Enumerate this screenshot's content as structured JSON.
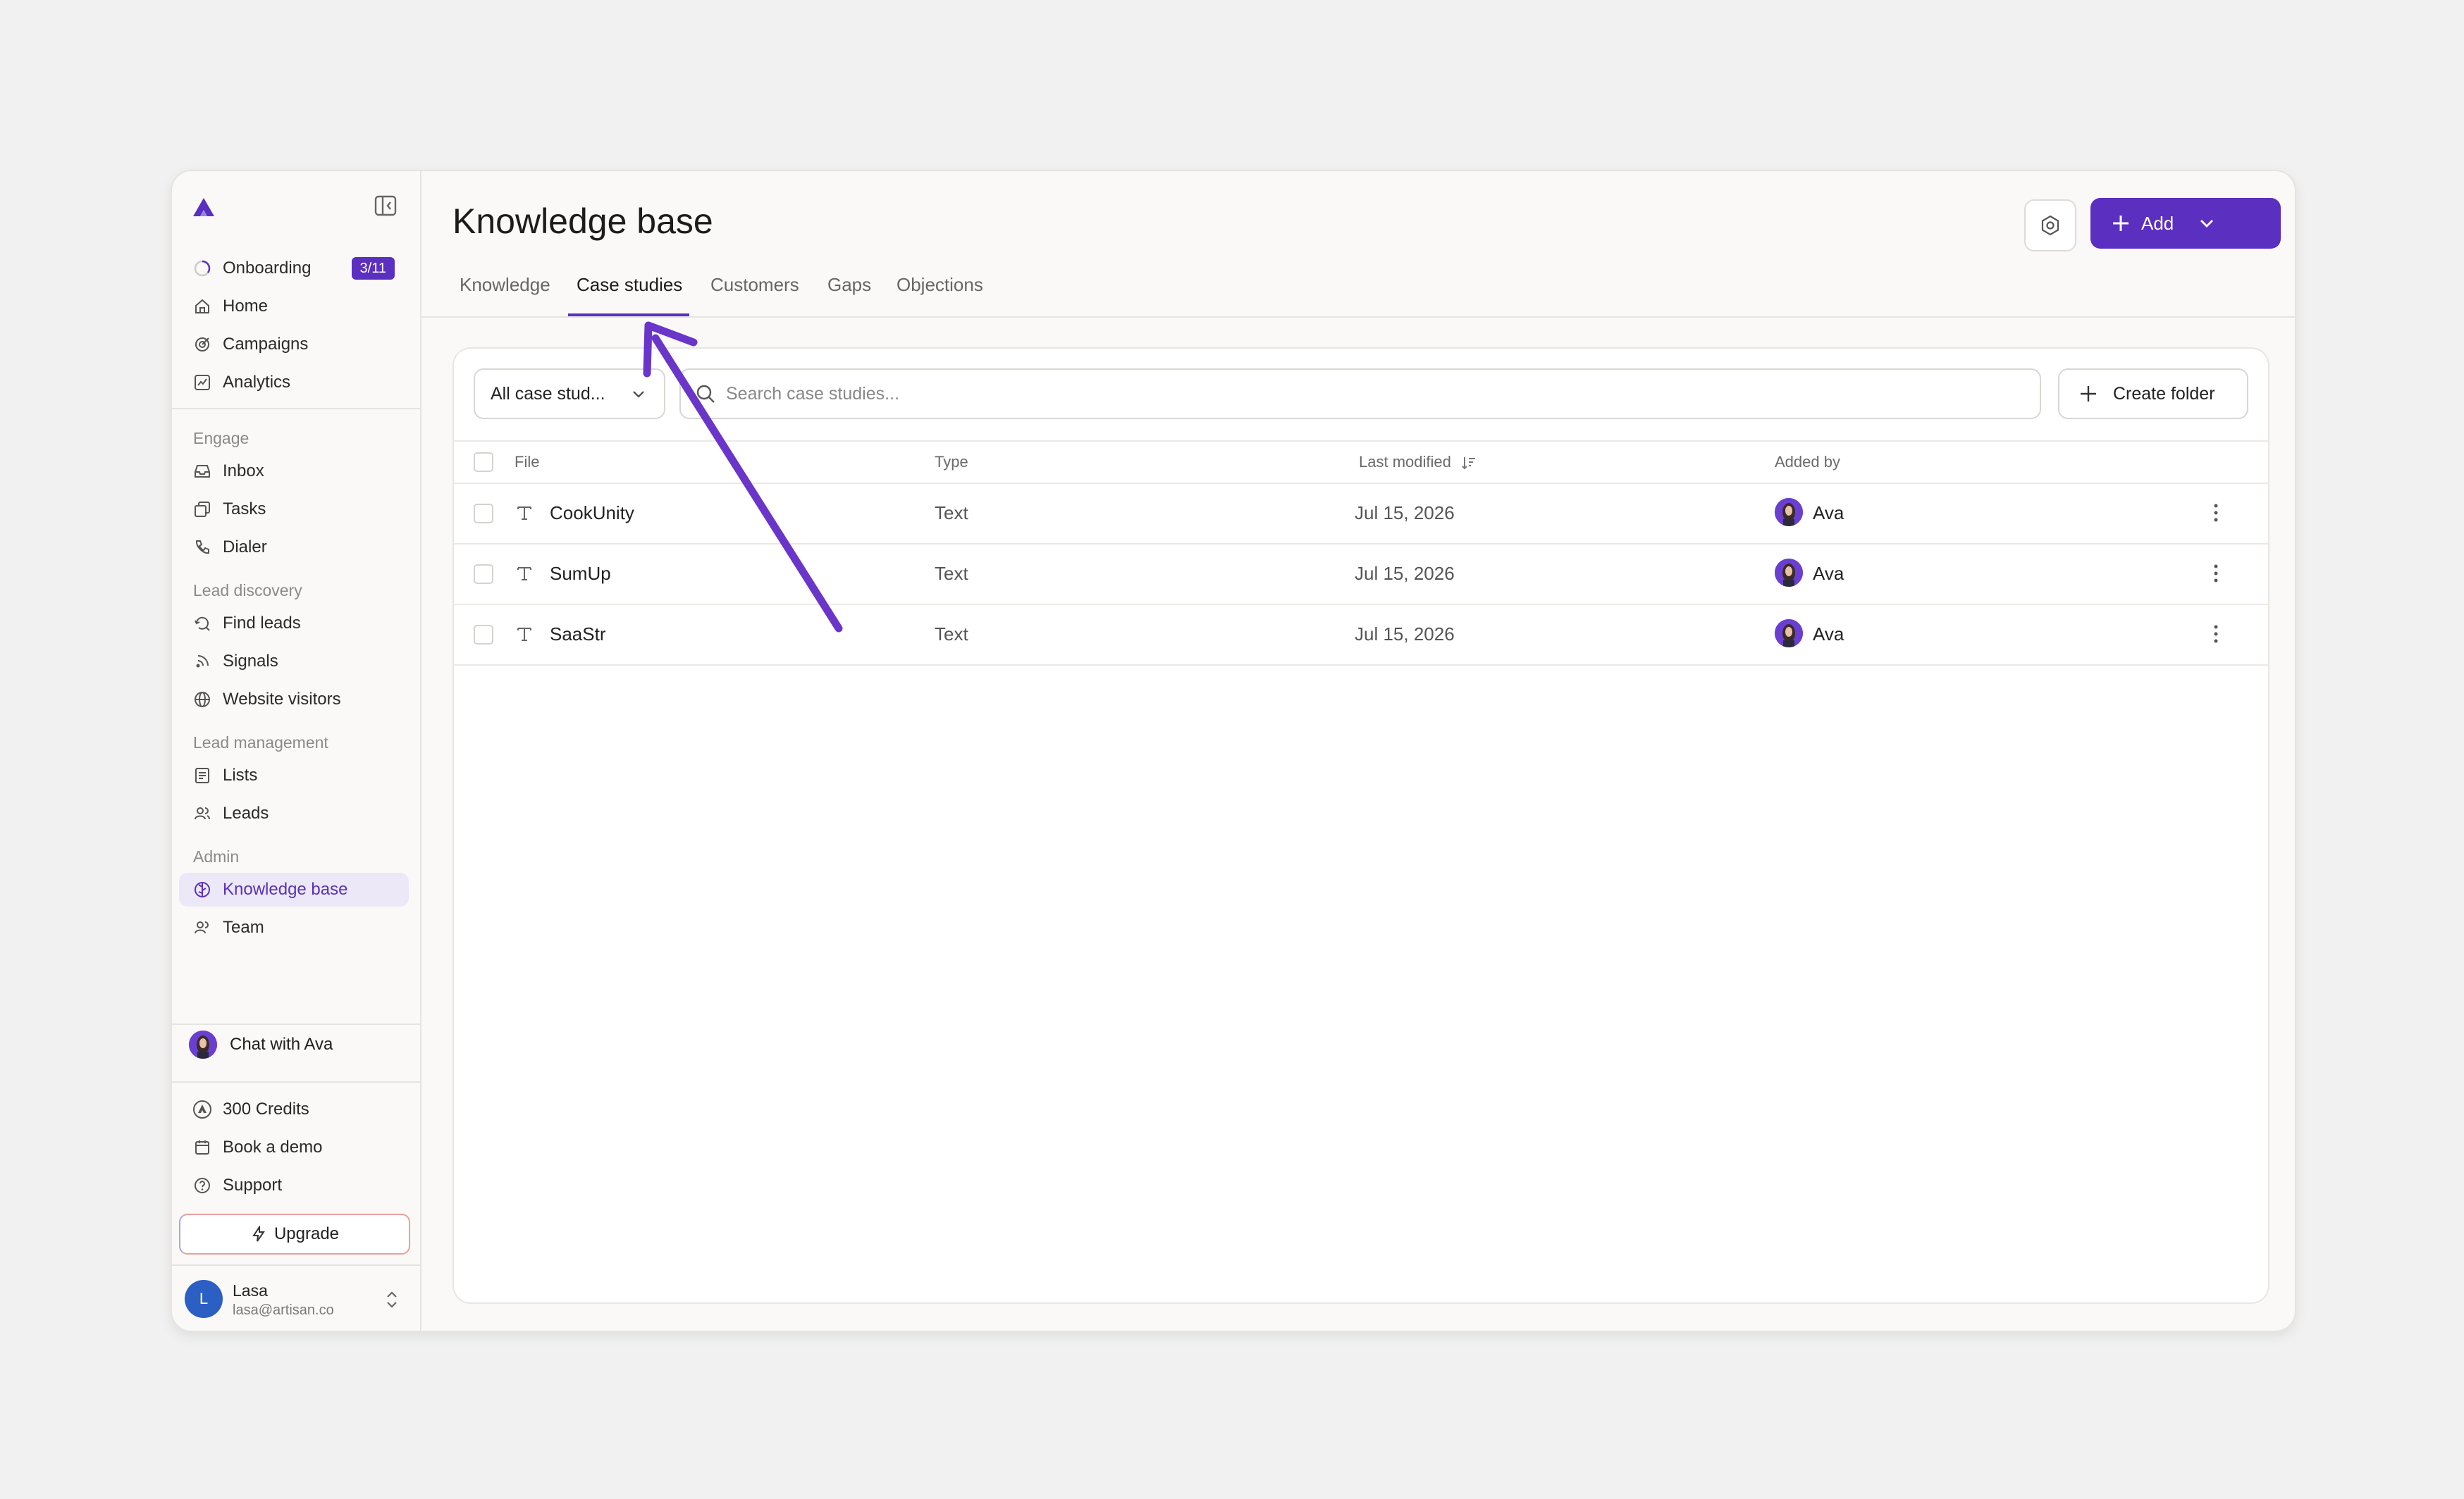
{
  "sidebar": {
    "nav_primary": [
      {
        "label": "Onboarding",
        "icon": "progress-circle-icon",
        "badge": "3/11"
      },
      {
        "label": "Home",
        "icon": "home-icon"
      },
      {
        "label": "Campaigns",
        "icon": "target-icon"
      },
      {
        "label": "Analytics",
        "icon": "chart-icon"
      }
    ],
    "sections": {
      "engage": "Engage",
      "lead_discovery": "Lead discovery",
      "lead_management": "Lead management",
      "admin": "Admin"
    },
    "engage_items": [
      {
        "label": "Inbox",
        "icon": "inbox-icon"
      },
      {
        "label": "Tasks",
        "icon": "tasks-icon"
      },
      {
        "label": "Dialer",
        "icon": "phone-icon"
      }
    ],
    "discovery_items": [
      {
        "label": "Find leads",
        "icon": "search-refresh-icon"
      },
      {
        "label": "Signals",
        "icon": "signal-icon"
      },
      {
        "label": "Website visitors",
        "icon": "globe-icon"
      }
    ],
    "management_items": [
      {
        "label": "Lists",
        "icon": "list-icon"
      },
      {
        "label": "Leads",
        "icon": "users-icon"
      }
    ],
    "admin_items": [
      {
        "label": "Knowledge base",
        "icon": "brain-icon",
        "active": true
      },
      {
        "label": "Team",
        "icon": "team-icon"
      }
    ],
    "chat_label": "Chat with Ava",
    "footer_items": [
      {
        "label": "300 Credits",
        "icon": "credits-icon"
      },
      {
        "label": "Book a demo",
        "icon": "calendar-icon"
      },
      {
        "label": "Support",
        "icon": "help-icon"
      }
    ],
    "upgrade_label": "Upgrade",
    "user": {
      "initial": "L",
      "name": "Lasa",
      "email": "lasa@artisan.co"
    }
  },
  "header": {
    "title": "Knowledge base",
    "add_label": "Add"
  },
  "tabs": [
    {
      "label": "Knowledge",
      "active": false
    },
    {
      "label": "Case studies",
      "active": true
    },
    {
      "label": "Customers",
      "active": false
    },
    {
      "label": "Gaps",
      "active": false
    },
    {
      "label": "Objections",
      "active": false
    }
  ],
  "toolbar": {
    "filter_value": "All case stud...",
    "search_placeholder": "Search case studies...",
    "create_folder_label": "Create folder"
  },
  "table": {
    "columns": [
      "File",
      "Type",
      "Last modified",
      "Added by"
    ],
    "rows": [
      {
        "file": "CookUnity",
        "type": "Text",
        "modified": "Jul 15, 2026",
        "added_by": "Ava"
      },
      {
        "file": "SumUp",
        "type": "Text",
        "modified": "Jul 15, 2026",
        "added_by": "Ava"
      },
      {
        "file": "SaaStr",
        "type": "Text",
        "modified": "Jul 15, 2026",
        "added_by": "Ava"
      }
    ]
  },
  "colors": {
    "accent": "#5b2fc0",
    "active_bg": "#ece8f7",
    "annotation_arrow": "#6a35c9"
  }
}
